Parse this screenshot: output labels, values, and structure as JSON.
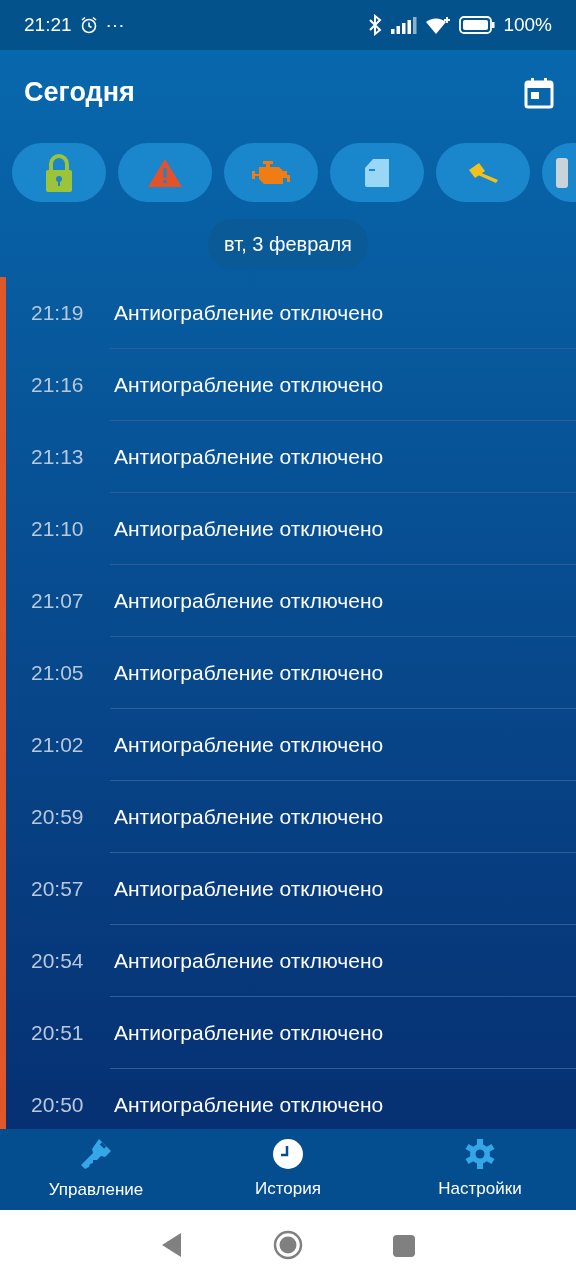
{
  "status_bar": {
    "time": "21:21",
    "dots": "···",
    "battery": "100%"
  },
  "app_bar": {
    "title": "Сегодня"
  },
  "filters": [
    {
      "kind": "lock"
    },
    {
      "kind": "alert"
    },
    {
      "kind": "engine"
    },
    {
      "kind": "door"
    },
    {
      "kind": "hammer"
    },
    {
      "kind": "other"
    }
  ],
  "date_header": "вт, 3 февраля",
  "events": [
    {
      "time": "21:19",
      "text": "Антиограбление отключено"
    },
    {
      "time": "21:16",
      "text": "Антиограбление отключено"
    },
    {
      "time": "21:13",
      "text": "Антиограбление отключено"
    },
    {
      "time": "21:10",
      "text": "Антиограбление отключено"
    },
    {
      "time": "21:07",
      "text": "Антиограбление отключено"
    },
    {
      "time": "21:05",
      "text": "Антиограбление отключено"
    },
    {
      "time": "21:02",
      "text": "Антиограбление отключено"
    },
    {
      "time": "20:59",
      "text": "Антиограбление отключено"
    },
    {
      "time": "20:57",
      "text": "Антиограбление отключено"
    },
    {
      "time": "20:54",
      "text": "Антиограбление отключено"
    },
    {
      "time": "20:51",
      "text": "Антиограбление отключено"
    },
    {
      "time": "20:50",
      "text": "Антиограбление отключено"
    }
  ],
  "bottom_nav": [
    {
      "kind": "key",
      "label": "Управление",
      "selected": false
    },
    {
      "kind": "clock",
      "label": "История",
      "selected": true
    },
    {
      "kind": "gear",
      "label": "Настройки",
      "selected": false
    }
  ]
}
